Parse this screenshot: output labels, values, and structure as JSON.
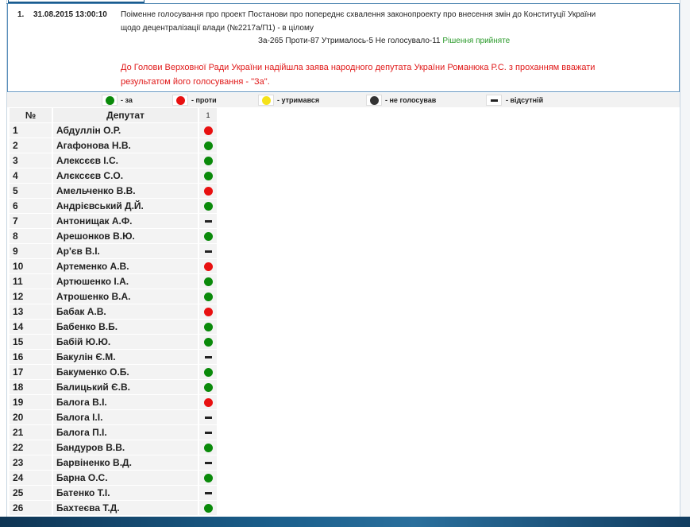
{
  "vote": {
    "number": "1.",
    "datetime": "31.08.2015 13:00:10",
    "title_line1": "Поіменне голосування про проект Постанови про попереднє схвалення законопроекту про внесення змін до Конституції України",
    "title_line2": "щодо децентралізації влади (№2217а/П1) - в цілому",
    "result": "За-265 Проти-87 Утрималось-5 Не голосувало-11",
    "decision": "Рішення прийняте",
    "note_line1": "До Голови Верховної Ради України надійшла заява народного депутата України Романюка Р.С. з проханням вважати",
    "note_line2": "результатом його голосування - \"За\"."
  },
  "legend": {
    "for": "- за",
    "against": "- проти",
    "abstain": "- утримався",
    "not_voted": "- не голосував",
    "absent": "- відсутній"
  },
  "colors": {
    "for": "#0a8a0a",
    "against": "#e81010",
    "abstain": "#f5e21a",
    "not_voted": "#333333",
    "absent": "#222222"
  },
  "table": {
    "col_num": "№",
    "col_name": "Депутат",
    "col_vote": "1"
  },
  "deputies": [
    {
      "num": "1",
      "name": "Абдуллін О.Р.",
      "vote": "against"
    },
    {
      "num": "2",
      "name": "Агафонова Н.В.",
      "vote": "for"
    },
    {
      "num": "3",
      "name": "Алексєєв І.С.",
      "vote": "for"
    },
    {
      "num": "4",
      "name": "Алєксєєв С.О.",
      "vote": "for"
    },
    {
      "num": "5",
      "name": "Амельченко В.В.",
      "vote": "against"
    },
    {
      "num": "6",
      "name": "Андрієвський Д.Й.",
      "vote": "for"
    },
    {
      "num": "7",
      "name": "Антонищак А.Ф.",
      "vote": "absent"
    },
    {
      "num": "8",
      "name": "Арешонков В.Ю.",
      "vote": "for"
    },
    {
      "num": "9",
      "name": "Ар'єв В.І.",
      "vote": "absent"
    },
    {
      "num": "10",
      "name": "Артеменко А.В.",
      "vote": "against"
    },
    {
      "num": "11",
      "name": "Артюшенко І.А.",
      "vote": "for"
    },
    {
      "num": "12",
      "name": "Атрошенко В.А.",
      "vote": "for"
    },
    {
      "num": "13",
      "name": "Бабак А.В.",
      "vote": "against"
    },
    {
      "num": "14",
      "name": "Бабенко В.Б.",
      "vote": "for"
    },
    {
      "num": "15",
      "name": "Бабій Ю.Ю.",
      "vote": "for"
    },
    {
      "num": "16",
      "name": "Бакулін Є.М.",
      "vote": "absent"
    },
    {
      "num": "17",
      "name": "Бакуменко О.Б.",
      "vote": "for"
    },
    {
      "num": "18",
      "name": "Балицький Є.В.",
      "vote": "for"
    },
    {
      "num": "19",
      "name": "Балога В.І.",
      "vote": "against"
    },
    {
      "num": "20",
      "name": "Балога І.І.",
      "vote": "absent"
    },
    {
      "num": "21",
      "name": "Балога П.І.",
      "vote": "absent"
    },
    {
      "num": "22",
      "name": "Бандуров В.В.",
      "vote": "for"
    },
    {
      "num": "23",
      "name": "Барвіненко В.Д.",
      "vote": "absent"
    },
    {
      "num": "24",
      "name": "Барна О.С.",
      "vote": "for"
    },
    {
      "num": "25",
      "name": "Батенко Т.І.",
      "vote": "absent"
    },
    {
      "num": "26",
      "name": "Бахтеєва Т.Д.",
      "vote": "for"
    }
  ]
}
